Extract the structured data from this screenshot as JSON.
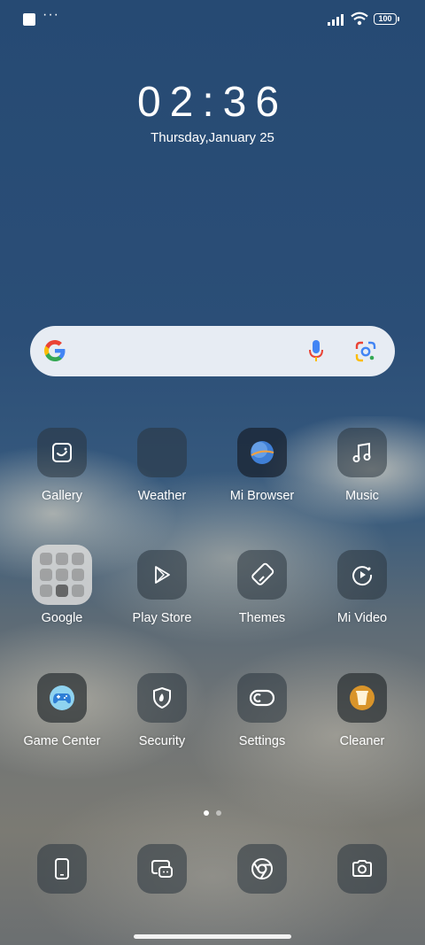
{
  "status_bar": {
    "battery": "100",
    "overflow": "···"
  },
  "clock": {
    "time": "02:36",
    "date": "Thursday,January 25"
  },
  "search_bar": {
    "logo": "google-g-icon",
    "voice": "mic-icon",
    "camera": "google-lens-icon"
  },
  "apps": [
    {
      "id": "gallery",
      "label": "Gallery",
      "icon": "gallery-icon"
    },
    {
      "id": "weather",
      "label": "Weather",
      "icon": "weather-icon"
    },
    {
      "id": "mi-browser",
      "label": "Mi Browser",
      "icon": "browser-globe-icon"
    },
    {
      "id": "music",
      "label": "Music",
      "icon": "music-note-icon"
    },
    {
      "id": "google",
      "label": "Google",
      "icon": "folder-icon"
    },
    {
      "id": "play-store",
      "label": "Play Store",
      "icon": "play-store-icon"
    },
    {
      "id": "themes",
      "label": "Themes",
      "icon": "themes-brush-icon"
    },
    {
      "id": "mi-video",
      "label": "Mi Video",
      "icon": "video-play-icon"
    },
    {
      "id": "game-center",
      "label": "Game Center",
      "icon": "gamepad-icon"
    },
    {
      "id": "security",
      "label": "Security",
      "icon": "shield-icon"
    },
    {
      "id": "settings",
      "label": "Settings",
      "icon": "settings-toggle-icon"
    },
    {
      "id": "cleaner",
      "label": "Cleaner",
      "icon": "trash-bin-icon"
    }
  ],
  "dock": [
    {
      "id": "phone",
      "icon": "phone-icon"
    },
    {
      "id": "messaging",
      "icon": "message-icon"
    },
    {
      "id": "chrome",
      "icon": "chrome-icon"
    },
    {
      "id": "camera",
      "icon": "camera-icon"
    }
  ],
  "pager": {
    "pages": 2,
    "active": 1
  },
  "colors": {
    "wallpaper_top": "#264a73",
    "search_bg": "#e7ecf3",
    "google_blue": "#4285F4",
    "google_red": "#EA4335",
    "google_yellow": "#FBBC05",
    "google_green": "#34A853"
  }
}
